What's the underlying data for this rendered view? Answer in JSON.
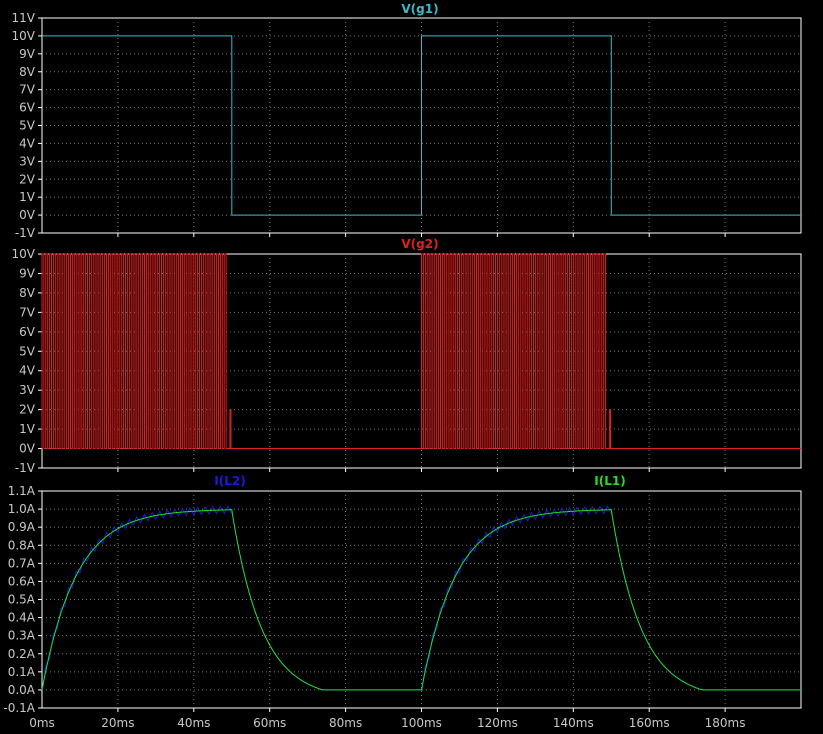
{
  "colors": {
    "background": "#000000",
    "frame": "#ffffff",
    "grid": "#7a7a7a",
    "tick_text": "#c8c8c8",
    "vg1": "#3fb8c8",
    "vg2": "#e02020",
    "il2": "#1a1ae0",
    "il1": "#20e020"
  },
  "chart_data": [
    {
      "type": "line",
      "name": "top-pane",
      "title": "V(g1)",
      "x_unit": "ms",
      "xlim": [
        0,
        200
      ],
      "ylim": [
        -1,
        11
      ],
      "y_ticks": [
        "-1V",
        "0V",
        "1V",
        "2V",
        "3V",
        "4V",
        "5V",
        "6V",
        "7V",
        "8V",
        "9V",
        "10V",
        "11V"
      ],
      "grid": true,
      "series": [
        {
          "name": "V(g1)",
          "color": "#3fb8c8",
          "x": [
            0,
            50,
            50,
            100,
            100,
            150,
            150,
            200
          ],
          "y": [
            10,
            10,
            0,
            0,
            10,
            10,
            0,
            0
          ]
        }
      ]
    },
    {
      "type": "line",
      "name": "middle-pane",
      "title": "V(g2)",
      "x_unit": "ms",
      "xlim": [
        0,
        200
      ],
      "ylim": [
        -1,
        10
      ],
      "y_ticks": [
        "-1V",
        "0V",
        "1V",
        "2V",
        "3V",
        "4V",
        "5V",
        "6V",
        "7V",
        "8V",
        "9V",
        "10V"
      ],
      "grid": true,
      "series": [
        {
          "name": "V(g2)",
          "color": "#e02020",
          "pwm": {
            "period_ms": 1,
            "duty": 0.5,
            "high": 10,
            "low": 0,
            "bursts": [
              [
                0,
                49
              ],
              [
                100,
                149
              ]
            ],
            "tail_pulses": [
              {
                "t": 49.5,
                "high": 2
              },
              {
                "t": 149.5,
                "high": 2
              }
            ]
          }
        }
      ]
    },
    {
      "type": "line",
      "name": "bottom-pane",
      "title": "",
      "x_unit": "ms",
      "xlim": [
        0,
        200
      ],
      "ylim": [
        -0.1,
        1.1
      ],
      "y_ticks": [
        "-0.1A",
        "0.0A",
        "0.1A",
        "0.2A",
        "0.3A",
        "0.4A",
        "0.5A",
        "0.6A",
        "0.7A",
        "0.8A",
        "0.9A",
        "1.0A",
        "1.1A"
      ],
      "x_ticks": [
        "0ms",
        "20ms",
        "40ms",
        "60ms",
        "80ms",
        "100ms",
        "120ms",
        "140ms",
        "160ms",
        "180ms"
      ],
      "grid": true,
      "series": [
        {
          "name": "I(L2)",
          "color": "#1a1ae0",
          "model": {
            "tau_rise_ms": 9,
            "tau_fall_ms": 8,
            "on": [
              [
                0,
                50
              ],
              [
                100,
                150
              ]
            ],
            "ripple": 0.06,
            "ripple_period_ms": 2,
            "peak": 1.0,
            "zero_after_ms": 24
          }
        },
        {
          "name": "I(L1)",
          "color": "#20e020",
          "model": {
            "tau_rise_ms": 9,
            "tau_fall_ms": 8,
            "on": [
              [
                0,
                50
              ],
              [
                100,
                150
              ]
            ],
            "ripple": 0,
            "peak": 1.0,
            "zero_after_ms": 24
          }
        }
      ]
    }
  ]
}
